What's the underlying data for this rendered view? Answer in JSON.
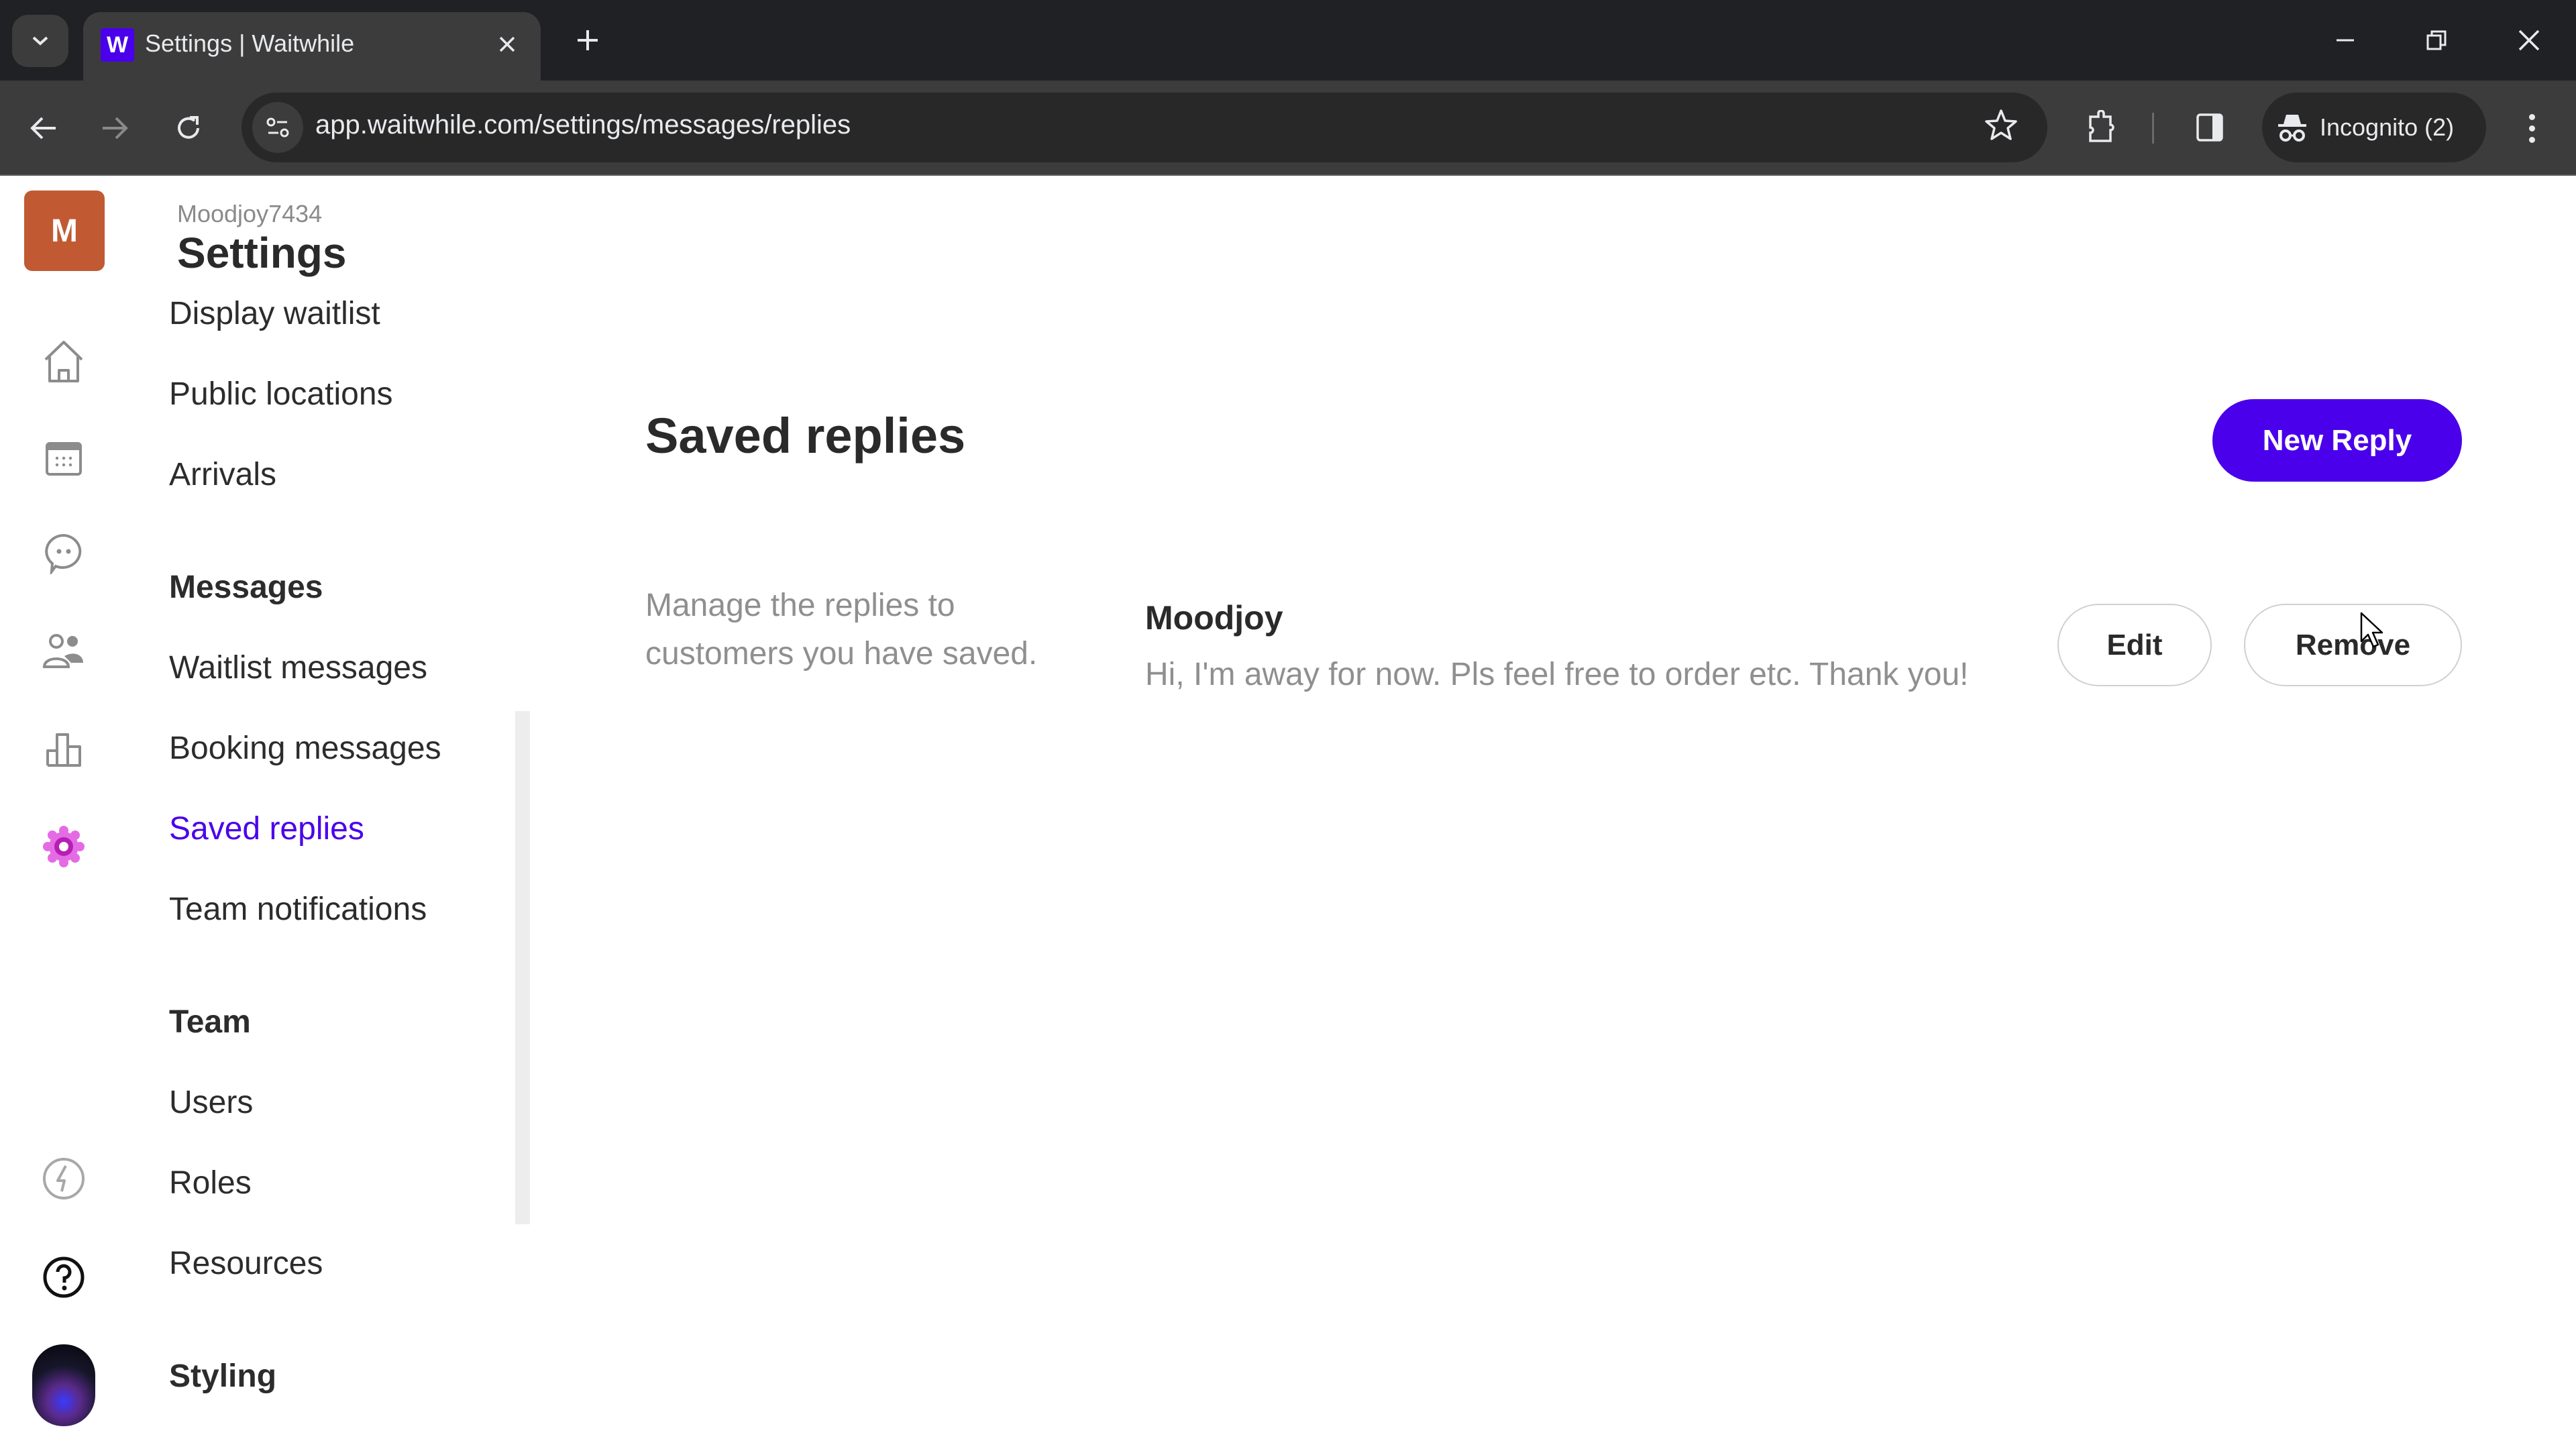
{
  "browser": {
    "tab_title": "Settings | Waitwhile",
    "favicon_letter": "W",
    "url": "app.waitwhile.com/settings/messages/replies",
    "incognito_label": "Incognito (2)",
    "icons": {
      "tab_search": "chevron-down-icon",
      "close_tab": "close-icon",
      "new_tab": "plus-icon",
      "back": "arrow-left-icon",
      "forward": "arrow-right-icon",
      "reload": "reload-icon",
      "site_info": "tune-icon",
      "bookmark": "star-icon",
      "extensions": "puzzle-icon",
      "side_panel": "side-panel-icon",
      "incognito": "incognito-icon",
      "menu": "kebab-icon"
    }
  },
  "rail": {
    "org_initial": "M",
    "items": [
      {
        "name": "home",
        "icon": "home-icon"
      },
      {
        "name": "calendar",
        "icon": "calendar-icon"
      },
      {
        "name": "messages",
        "icon": "chat-icon"
      },
      {
        "name": "customers",
        "icon": "users-icon"
      },
      {
        "name": "analytics",
        "icon": "bar-chart-icon"
      },
      {
        "name": "settings",
        "icon": "gear-icon",
        "active": true
      },
      {
        "name": "whats-new",
        "icon": "lightning-icon"
      },
      {
        "name": "help",
        "icon": "help-icon"
      }
    ]
  },
  "sidebar": {
    "org_name": "Moodjoy7434",
    "title": "Settings",
    "items": [
      {
        "label": "Display waitlist",
        "type": "item"
      },
      {
        "label": "Public locations",
        "type": "item"
      },
      {
        "label": "Arrivals",
        "type": "item"
      },
      {
        "label": "Messages",
        "type": "heading"
      },
      {
        "label": "Waitlist messages",
        "type": "item"
      },
      {
        "label": "Booking messages",
        "type": "item"
      },
      {
        "label": "Saved replies",
        "type": "item",
        "active": true
      },
      {
        "label": "Team notifications",
        "type": "item"
      },
      {
        "label": "Team",
        "type": "heading"
      },
      {
        "label": "Users",
        "type": "item"
      },
      {
        "label": "Roles",
        "type": "item"
      },
      {
        "label": "Resources",
        "type": "item"
      },
      {
        "label": "Styling",
        "type": "heading"
      }
    ]
  },
  "main": {
    "title": "Saved replies",
    "new_reply_label": "New Reply",
    "description": "Manage the replies to customers you have saved.",
    "replies": [
      {
        "name": "Moodjoy",
        "body": "Hi, I'm away for now. Pls feel free to order etc. Thank you!",
        "edit_label": "Edit",
        "remove_label": "Remove"
      }
    ]
  },
  "colors": {
    "accent": "#4a00ea",
    "org_avatar": "#c15a32",
    "active_gear": "#d63fd6"
  }
}
